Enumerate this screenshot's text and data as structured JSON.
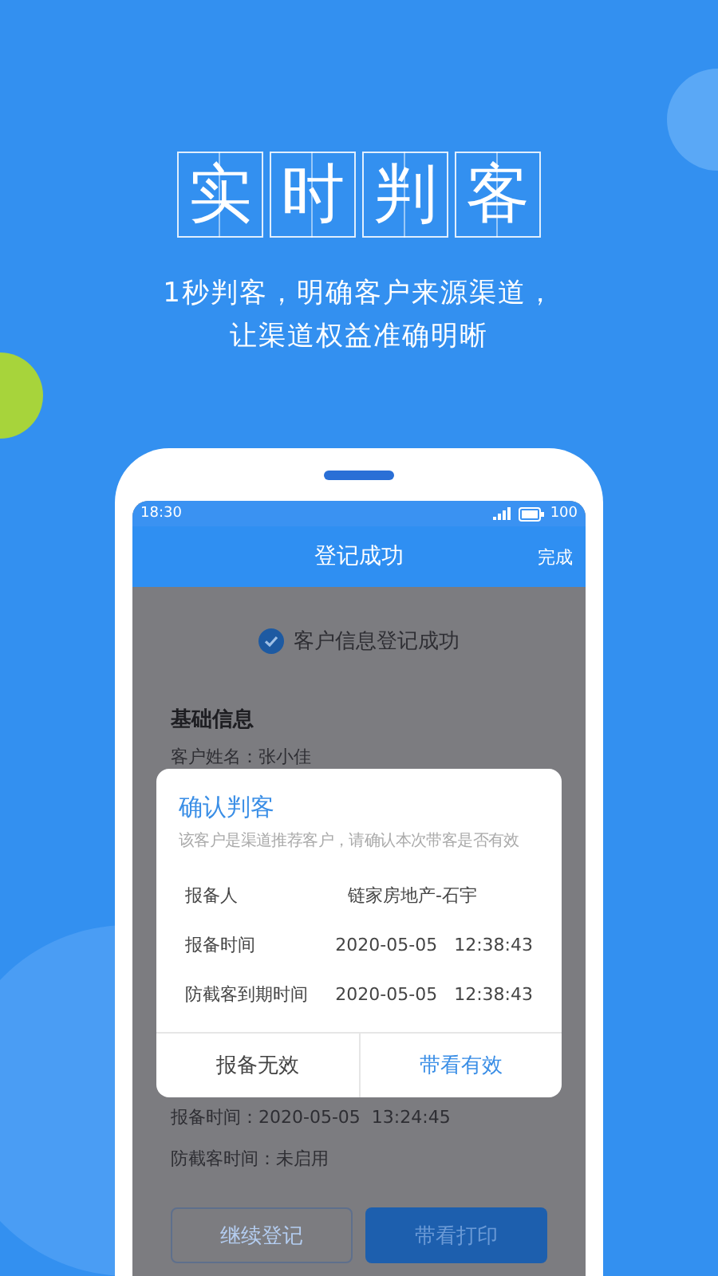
{
  "promo": {
    "title_chars": [
      "实",
      "时",
      "判",
      "客"
    ],
    "subtitle_lines": [
      "1秒判客，明确客户来源渠道，",
      "让渠道权益准确明晰"
    ]
  },
  "status_bar": {
    "time": "18:30",
    "battery": "100"
  },
  "nav": {
    "title": "登记成功",
    "action": "完成"
  },
  "success_message": "客户信息登记成功",
  "section_title": "基础信息",
  "info_rows": [
    "客户姓名：张小佳",
    "报备时间：2020-05-05  13:24:45",
    "防截客时间：未启用"
  ],
  "buttons": [
    {
      "label": "继续登记",
      "kind": "outline"
    },
    {
      "label": "带看打印",
      "kind": "primary"
    }
  ],
  "dialog": {
    "title": "确认判客",
    "message": "该客户是渠道推荐客户，请确认本次带客是否有效",
    "rows": [
      {
        "label": "报备人",
        "value": "链家房地产-石宇"
      },
      {
        "label": "报备时间",
        "value": "2020-05-05   12:38:43"
      },
      {
        "label": "防截客到期时间",
        "value": "2020-05-05   12:38:43"
      }
    ],
    "actions": [
      {
        "label": "报备无效",
        "kind": "secondary"
      },
      {
        "label": "带看有效",
        "kind": "primary"
      }
    ]
  }
}
